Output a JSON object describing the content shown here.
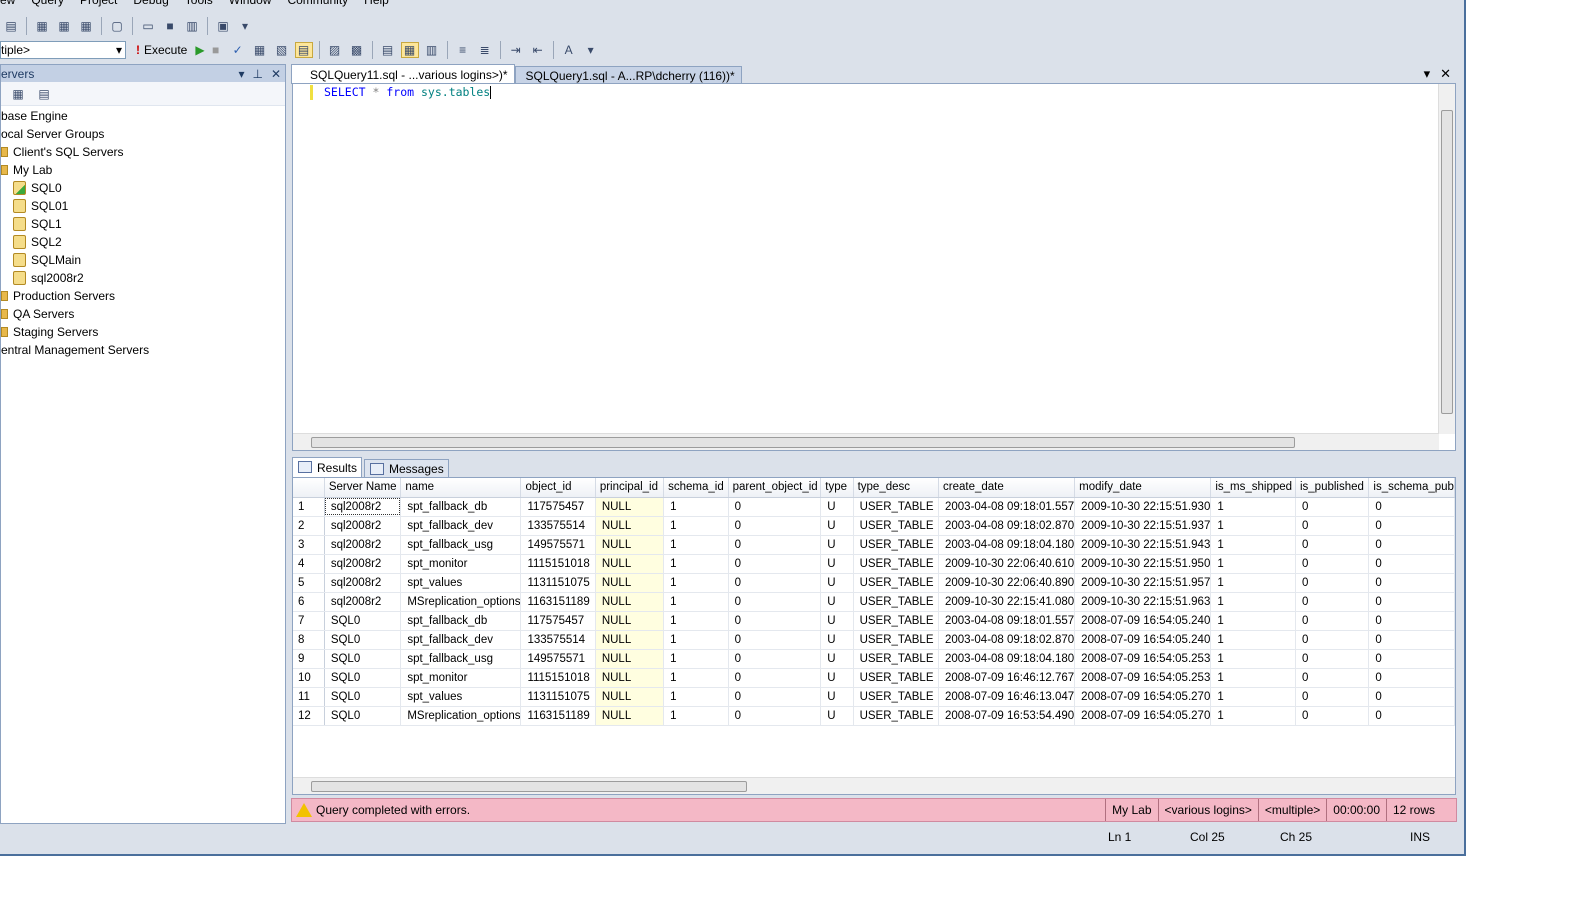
{
  "menu": [
    "ew",
    "Query",
    "Project",
    "Debug",
    "Tools",
    "Window",
    "Community",
    "Help"
  ],
  "toolbar": {
    "db_combo": "tiple>",
    "execute_label": "Execute"
  },
  "object_explorer": {
    "title": "ervers",
    "tree": [
      {
        "label": "base Engine",
        "indent": 0,
        "icon": "none"
      },
      {
        "label": "ocal Server Groups",
        "indent": 0,
        "icon": "none"
      },
      {
        "label": "Client's SQL Servers",
        "indent": 1,
        "icon": "folder"
      },
      {
        "label": "My Lab",
        "indent": 1,
        "icon": "folder"
      },
      {
        "label": "SQL0",
        "indent": 2,
        "icon": "server-running"
      },
      {
        "label": "SQL01",
        "indent": 2,
        "icon": "server"
      },
      {
        "label": "SQL1",
        "indent": 2,
        "icon": "server"
      },
      {
        "label": "SQL2",
        "indent": 2,
        "icon": "server"
      },
      {
        "label": "SQLMain",
        "indent": 2,
        "icon": "server"
      },
      {
        "label": "sql2008r2",
        "indent": 2,
        "icon": "server"
      },
      {
        "label": "Production Servers",
        "indent": 1,
        "icon": "folder"
      },
      {
        "label": "QA Servers",
        "indent": 1,
        "icon": "folder"
      },
      {
        "label": "Staging Servers",
        "indent": 1,
        "icon": "folder"
      },
      {
        "label": "entral Management Servers",
        "indent": 0,
        "icon": "none"
      }
    ]
  },
  "tabs": [
    {
      "label": "SQLQuery11.sql - ...various logins>)*",
      "active": true
    },
    {
      "label": "SQLQuery1.sql - A...RP\\dcherry (116))*",
      "active": false
    }
  ],
  "editor": {
    "kw1": "SELECT",
    "op": "*",
    "kw2": "from",
    "ident": "sys.tables"
  },
  "results": {
    "tab_results": "Results",
    "tab_messages": "Messages",
    "columns": [
      "Server Name",
      "name",
      "object_id",
      "principal_id",
      "schema_id",
      "parent_object_id",
      "type",
      "type_desc",
      "create_date",
      "modify_date",
      "is_ms_shipped",
      "is_published",
      "is_schema_pub"
    ],
    "rows": [
      [
        "1",
        "sql2008r2",
        "spt_fallback_db",
        "117575457",
        "NULL",
        "1",
        "0",
        "U",
        "USER_TABLE",
        "2003-04-08 09:18:01.557",
        "2009-10-30 22:15:51.930",
        "1",
        "0",
        "0"
      ],
      [
        "2",
        "sql2008r2",
        "spt_fallback_dev",
        "133575514",
        "NULL",
        "1",
        "0",
        "U",
        "USER_TABLE",
        "2003-04-08 09:18:02.870",
        "2009-10-30 22:15:51.937",
        "1",
        "0",
        "0"
      ],
      [
        "3",
        "sql2008r2",
        "spt_fallback_usg",
        "149575571",
        "NULL",
        "1",
        "0",
        "U",
        "USER_TABLE",
        "2003-04-08 09:18:04.180",
        "2009-10-30 22:15:51.943",
        "1",
        "0",
        "0"
      ],
      [
        "4",
        "sql2008r2",
        "spt_monitor",
        "1115151018",
        "NULL",
        "1",
        "0",
        "U",
        "USER_TABLE",
        "2009-10-30 22:06:40.610",
        "2009-10-30 22:15:51.950",
        "1",
        "0",
        "0"
      ],
      [
        "5",
        "sql2008r2",
        "spt_values",
        "1131151075",
        "NULL",
        "1",
        "0",
        "U",
        "USER_TABLE",
        "2009-10-30 22:06:40.890",
        "2009-10-30 22:15:51.957",
        "1",
        "0",
        "0"
      ],
      [
        "6",
        "sql2008r2",
        "MSreplication_options",
        "1163151189",
        "NULL",
        "1",
        "0",
        "U",
        "USER_TABLE",
        "2009-10-30 22:15:41.080",
        "2009-10-30 22:15:51.963",
        "1",
        "0",
        "0"
      ],
      [
        "7",
        "SQL0",
        "spt_fallback_db",
        "117575457",
        "NULL",
        "1",
        "0",
        "U",
        "USER_TABLE",
        "2003-04-08 09:18:01.557",
        "2008-07-09 16:54:05.240",
        "1",
        "0",
        "0"
      ],
      [
        "8",
        "SQL0",
        "spt_fallback_dev",
        "133575514",
        "NULL",
        "1",
        "0",
        "U",
        "USER_TABLE",
        "2003-04-08 09:18:02.870",
        "2008-07-09 16:54:05.240",
        "1",
        "0",
        "0"
      ],
      [
        "9",
        "SQL0",
        "spt_fallback_usg",
        "149575571",
        "NULL",
        "1",
        "0",
        "U",
        "USER_TABLE",
        "2003-04-08 09:18:04.180",
        "2008-07-09 16:54:05.253",
        "1",
        "0",
        "0"
      ],
      [
        "10",
        "SQL0",
        "spt_monitor",
        "1115151018",
        "NULL",
        "1",
        "0",
        "U",
        "USER_TABLE",
        "2008-07-09 16:46:12.767",
        "2008-07-09 16:54:05.253",
        "1",
        "0",
        "0"
      ],
      [
        "11",
        "SQL0",
        "spt_values",
        "1131151075",
        "NULL",
        "1",
        "0",
        "U",
        "USER_TABLE",
        "2008-07-09 16:46:13.047",
        "2008-07-09 16:54:05.270",
        "1",
        "0",
        "0"
      ],
      [
        "12",
        "SQL0",
        "MSreplication_options",
        "1163151189",
        "NULL",
        "1",
        "0",
        "U",
        "USER_TABLE",
        "2008-07-09 16:53:54.490",
        "2008-07-09 16:54:05.270",
        "1",
        "0",
        "0"
      ]
    ]
  },
  "query_status": {
    "message": "Query completed with errors.",
    "server": "My Lab",
    "login": "<various logins>",
    "database": "<multiple>",
    "elapsed": "00:00:00",
    "rows": "12 rows",
    "bg_color": "#f4b8c6"
  },
  "app_status": {
    "ln": "Ln 1",
    "col": "Col 25",
    "ch": "Ch 25",
    "mode": "INS"
  }
}
